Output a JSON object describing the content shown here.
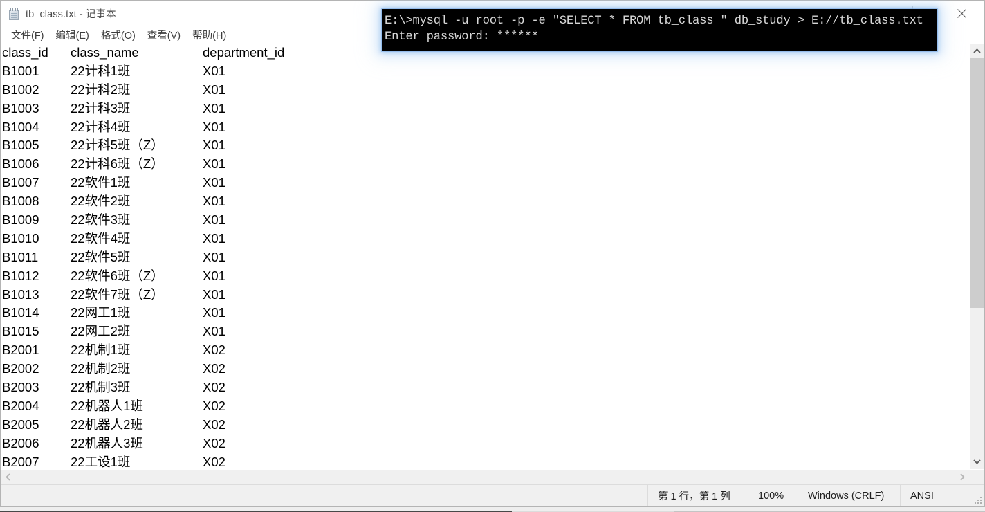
{
  "window": {
    "title": "tb_class.txt - 记事本",
    "icon": "notepad-icon",
    "buttons": {
      "minimize": "—",
      "maximize": "▢",
      "close": "✕"
    }
  },
  "menu": {
    "items": [
      {
        "label": "文件(F)"
      },
      {
        "label": "编辑(E)"
      },
      {
        "label": "格式(O)"
      },
      {
        "label": "查看(V)"
      },
      {
        "label": "帮助(H)"
      }
    ]
  },
  "document": {
    "headers": {
      "class_id": "class_id",
      "class_name": "class_name",
      "department_id": "department_id"
    },
    "rows": [
      {
        "class_id": "class_id",
        "class_name": "class_name",
        "department_id": "department_id"
      },
      {
        "class_id": "B1001",
        "class_name": "22计科1班",
        "department_id": "X01"
      },
      {
        "class_id": "B1002",
        "class_name": "22计科2班",
        "department_id": "X01"
      },
      {
        "class_id": "B1003",
        "class_name": "22计科3班",
        "department_id": "X01"
      },
      {
        "class_id": "B1004",
        "class_name": "22计科4班",
        "department_id": "X01"
      },
      {
        "class_id": "B1005",
        "class_name": "22计科5班（Z）",
        "department_id": "X01"
      },
      {
        "class_id": "B1006",
        "class_name": "22计科6班（Z）",
        "department_id": "X01"
      },
      {
        "class_id": "B1007",
        "class_name": "22软件1班",
        "department_id": "X01"
      },
      {
        "class_id": "B1008",
        "class_name": "22软件2班",
        "department_id": "X01"
      },
      {
        "class_id": "B1009",
        "class_name": "22软件3班",
        "department_id": "X01"
      },
      {
        "class_id": "B1010",
        "class_name": "22软件4班",
        "department_id": "X01"
      },
      {
        "class_id": "B1011",
        "class_name": "22软件5班",
        "department_id": "X01"
      },
      {
        "class_id": "B1012",
        "class_name": "22软件6班（Z）",
        "department_id": "X01"
      },
      {
        "class_id": "B1013",
        "class_name": "22软件7班（Z）",
        "department_id": "X01"
      },
      {
        "class_id": "B1014",
        "class_name": "22网工1班",
        "department_id": "X01"
      },
      {
        "class_id": "B1015",
        "class_name": "22网工2班",
        "department_id": "X01"
      },
      {
        "class_id": "B2001",
        "class_name": "22机制1班",
        "department_id": "X02"
      },
      {
        "class_id": "B2002",
        "class_name": "22机制2班",
        "department_id": "X02"
      },
      {
        "class_id": "B2003",
        "class_name": "22机制3班",
        "department_id": "X02"
      },
      {
        "class_id": "B2004",
        "class_name": "22机器人1班",
        "department_id": "X02"
      },
      {
        "class_id": "B2005",
        "class_name": "22机器人2班",
        "department_id": "X02"
      },
      {
        "class_id": "B2006",
        "class_name": "22机器人3班",
        "department_id": "X02"
      },
      {
        "class_id": "B2007",
        "class_name": "22工设1班",
        "department_id": "X02"
      }
    ]
  },
  "status_bar": {
    "position": "第 1 行，第 1 列",
    "zoom": "100%",
    "line_ending": "Windows (CRLF)",
    "encoding": "ANSI"
  },
  "console": {
    "lines": [
      "E:\\>mysql -u root -p -e \"SELECT * FROM tb_class \" db_study > E://tb_class.txt",
      "Enter password: ******"
    ],
    "background": "#000000",
    "text_color": "#d8d8d8",
    "glow_color": "#7aaee6"
  },
  "scrollbars": {
    "vertical_up": "▲",
    "vertical_down": "▼",
    "horizontal_left": "◀",
    "horizontal_right": "▶"
  }
}
